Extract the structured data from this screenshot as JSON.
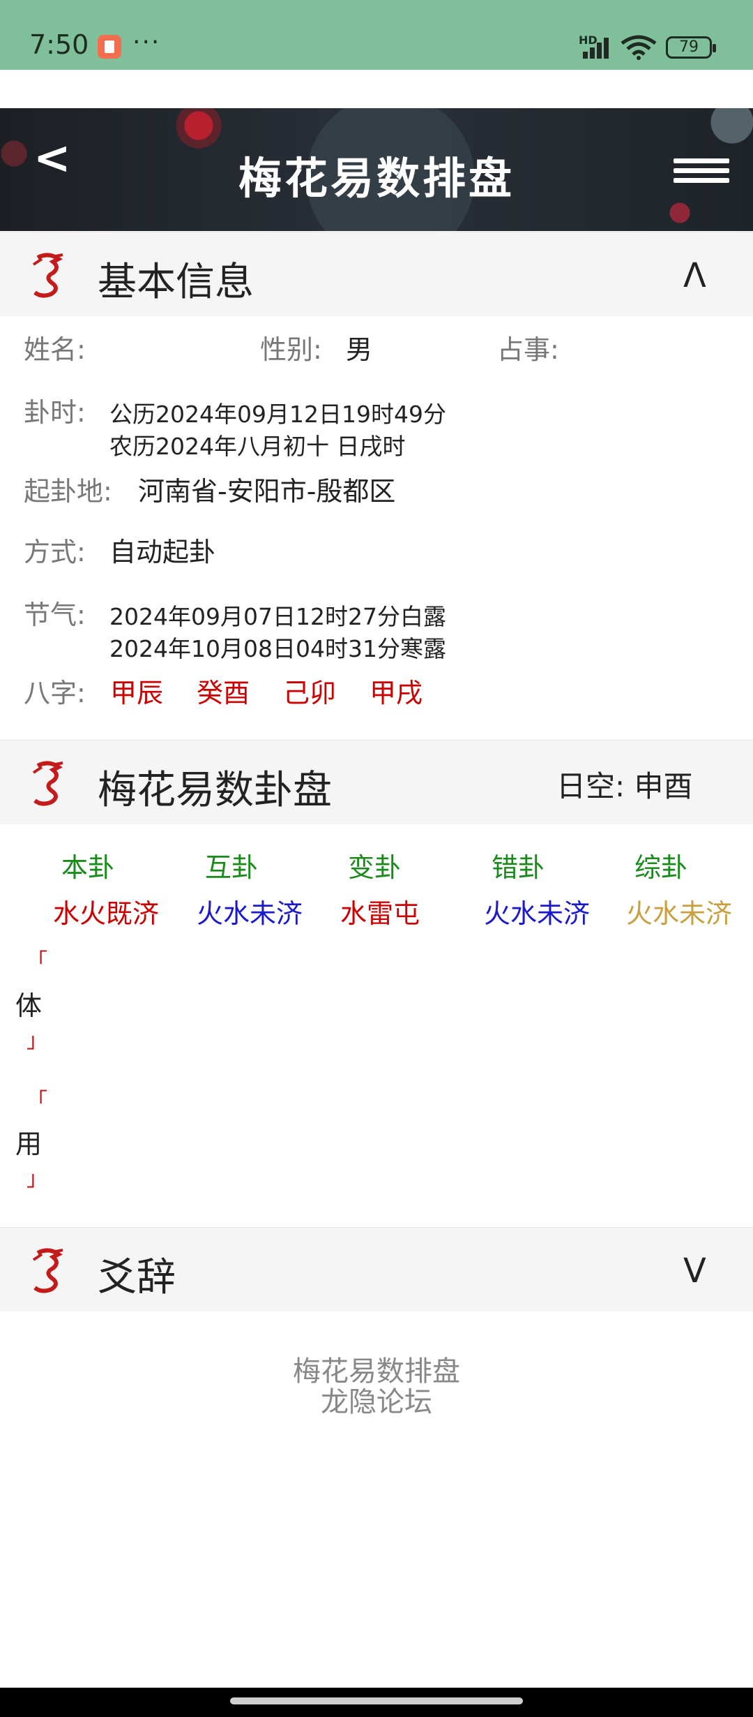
{
  "status_bar": {
    "time": "7:50",
    "dots": "···",
    "hd": "HD",
    "battery": "79"
  },
  "header": {
    "back": "<",
    "title": "梅花易数排盘"
  },
  "basic_info": {
    "title": "基本信息",
    "toggle": "Λ",
    "name_label": "姓名:",
    "name_value": "",
    "gender_label": "性别:",
    "gender_value": "男",
    "matter_label": "占事:",
    "matter_value": "",
    "time_label": "卦时:",
    "time_solar": "公历2024年09月12日19时49分",
    "time_lunar": "农历2024年八月初十 日戌时",
    "place_label": "起卦地:",
    "place_value": "河南省-安阳市-殷都区",
    "method_label": "方式:",
    "method_value": "自动起卦",
    "solar_term_label": "节气:",
    "solar_term_1": "2024年09月07日12时27分白露",
    "solar_term_2": "2024年10月08日04时31分寒露",
    "bazi_label": "八字:",
    "bazi": [
      "甲辰",
      "癸酉",
      "己卯",
      "甲戌"
    ]
  },
  "hexagram": {
    "title": "梅花易数卦盘",
    "rikong": "日空: 申酉",
    "columns": [
      {
        "label": "本卦",
        "name": "水火既济",
        "color": "#cc0000"
      },
      {
        "label": "互卦",
        "name": "火水未济",
        "color": "#1a1acc"
      },
      {
        "label": "变卦",
        "name": "水雷屯",
        "color": "#cc0000"
      },
      {
        "label": "错卦",
        "name": "火水未济",
        "color": "#1a1acc"
      },
      {
        "label": "综卦",
        "name": "火水未济",
        "color": "#c8a040"
      }
    ],
    "ti": "体",
    "yong": "用",
    "bracket_top": "「",
    "bracket_bottom": "」"
  },
  "yaoci": {
    "title": "爻辞",
    "toggle": "V"
  },
  "footer": {
    "line1": "梅花易数排盘",
    "line2": "龙隐论坛"
  }
}
